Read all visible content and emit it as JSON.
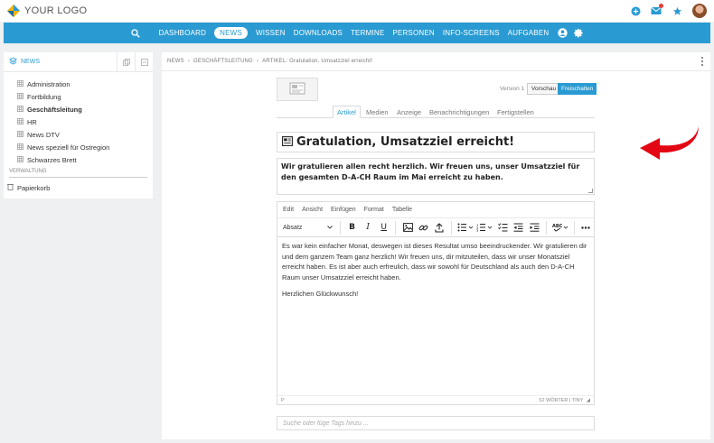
{
  "header": {
    "logo_text": "YOUR LOGO",
    "icons": [
      "plus-circle-icon",
      "mail-icon",
      "star-icon",
      "avatar"
    ]
  },
  "nav": {
    "items": [
      {
        "label": "DASHBOARD",
        "active": false
      },
      {
        "label": "NEWS",
        "active": true
      },
      {
        "label": "WISSEN",
        "active": false
      },
      {
        "label": "DOWNLOADS",
        "active": false
      },
      {
        "label": "TERMINE",
        "active": false
      },
      {
        "label": "PERSONEN",
        "active": false
      },
      {
        "label": "INFO-SCREENS",
        "active": false
      },
      {
        "label": "AUFGABEN",
        "active": false
      }
    ]
  },
  "sidebar": {
    "title": "NEWS",
    "items": [
      {
        "label": "Administration",
        "bold": false
      },
      {
        "label": "Fortbildung",
        "bold": false
      },
      {
        "label": "Geschäftsleitung",
        "bold": true
      },
      {
        "label": "HR",
        "bold": false
      },
      {
        "label": "News DTV",
        "bold": false
      },
      {
        "label": "News speziell für Ostregion",
        "bold": false
      },
      {
        "label": "Schwarzes Brett",
        "bold": false
      }
    ],
    "section_label": "VERWALTUNG",
    "trash_label": "Papierkorb"
  },
  "breadcrumb": {
    "items": [
      "NEWS",
      "GESCHÄFTSLEITUNG",
      "ARTIKEL: Gratulation, Umsatzziel erreicht!"
    ]
  },
  "article": {
    "version_label": "Version 1",
    "preview_label": "Vorschau",
    "release_label": "Freischalten",
    "tabs": [
      "Artikel",
      "Medien",
      "Anzeige",
      "Benachrichtigungen",
      "Fertigstellen"
    ],
    "active_tab": "Artikel",
    "title": "Gratulation, Umsatzziel erreicht!",
    "lead": "Wir gratulieren allen recht herzlich. Wir freuen uns, unser Umsatzziel für den gesamten D-A-CH Raum im Mai erreicht zu haben.",
    "tags_placeholder": "Suche oder füge Tags hinzu ..."
  },
  "editor": {
    "menu": [
      "Edit",
      "Ansicht",
      "Einfügen",
      "Format",
      "Tabelle"
    ],
    "format_select": "Absatz",
    "paragraphs": [
      "Es war kein einfacher Monat, deswegen ist dieses Resultat umso beeindruckender. Wir gratulieren dir und dem ganzem Team ganz herzlich! Wir freuen uns, dir mitzuteilen, dass  wir unser Monatsziel erreicht haben. Es ist aber auch erfreulich, dass wir sowohl für Deutschland als auch den D-A-CH Raum unser Umsatzziel erreicht haben.",
      "Herzlichen Glückwunsch!"
    ],
    "status_path": "P",
    "status_words": "52 WÖRTER",
    "status_brand": "TINY"
  },
  "colors": {
    "accent": "#2a9bd2",
    "arrow": "#e30613"
  }
}
